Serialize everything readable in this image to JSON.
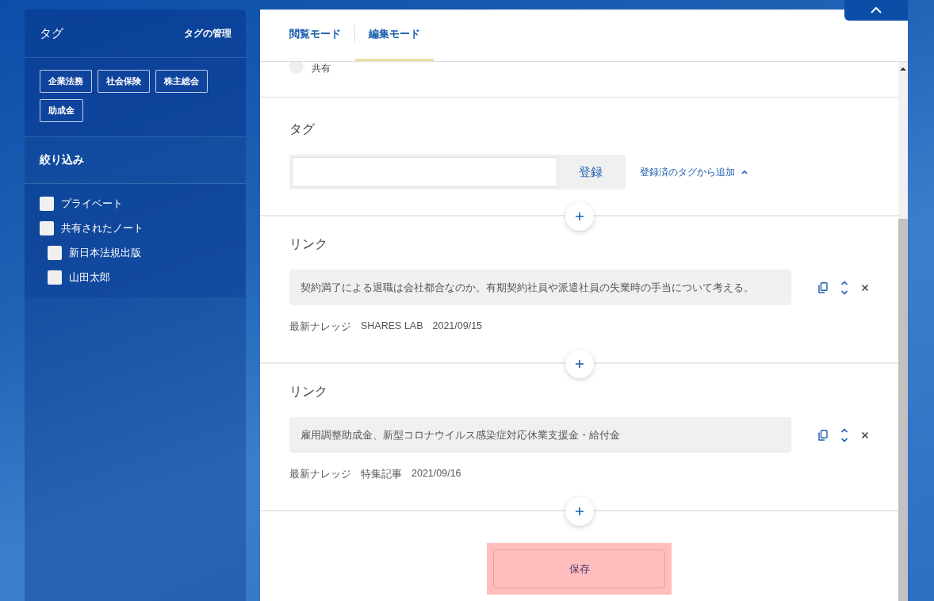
{
  "sidebar": {
    "title": "タグ",
    "manage_link": "タグの管理",
    "tags": [
      "企業法務",
      "社会保険",
      "株主総会",
      "助成金"
    ],
    "filter_title": "絞り込み",
    "filters": [
      {
        "label": "プライベート",
        "checked": false
      },
      {
        "label": "共有されたノート",
        "checked": false,
        "children": [
          {
            "label": "新日本法規出版",
            "checked": false
          },
          {
            "label": "山田太郎",
            "checked": false
          }
        ]
      }
    ]
  },
  "tabs": [
    {
      "label": "閲覧モード",
      "selected": false
    },
    {
      "label": "編集モード",
      "selected": true
    }
  ],
  "share_option": {
    "label": "共有",
    "selected": false
  },
  "tag_section": {
    "title": "タグ",
    "register_button": "登録",
    "add_from_registered": "登録済のタグから追加",
    "expanded": true
  },
  "links": [
    {
      "title": "リンク",
      "text": "契約満了による退職は会社都合なのか。有期契約社員や派遣社員の失業時の手当について考える。",
      "source": "最新ナレッジ",
      "category": "SHARES LAB",
      "date": "2021/09/15"
    },
    {
      "title": "リンク",
      "text": "雇用調整助成金、新型コロナウイルス感染症対応休業支援金・給付金",
      "source": "最新ナレッジ",
      "category": "特集記事",
      "date": "2021/09/16"
    }
  ],
  "save_button": "保存"
}
